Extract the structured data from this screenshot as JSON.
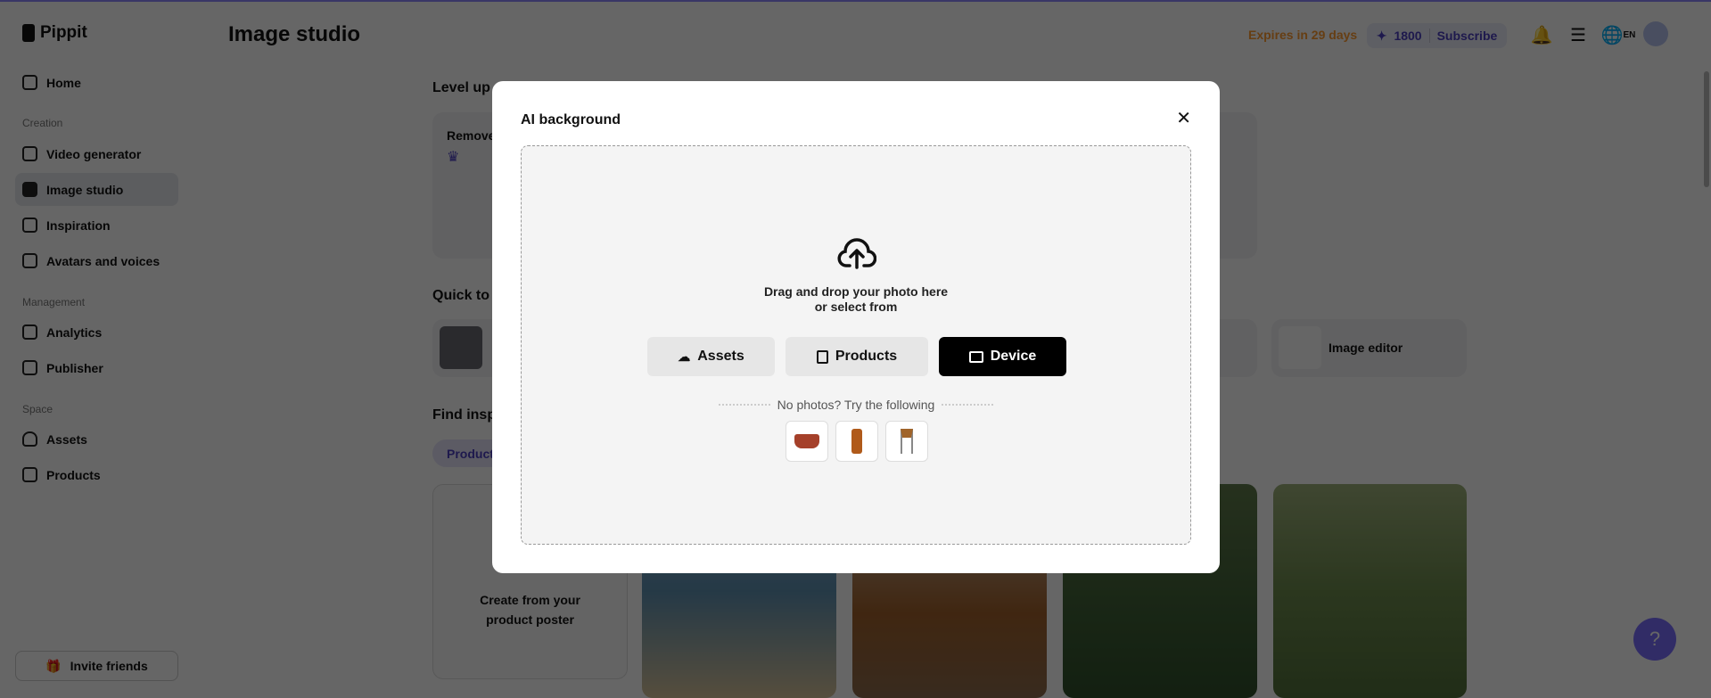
{
  "app": {
    "logo": "Pippit",
    "page_title": "Image studio"
  },
  "header": {
    "expires": "Expires in 29 days",
    "credits": "1800",
    "subscribe": "Subscribe",
    "language": "EN"
  },
  "sidebar": {
    "home": "Home",
    "sections": [
      {
        "label": "Creation",
        "items": [
          "Video generator",
          "Image studio",
          "Inspiration",
          "Avatars and voices"
        ]
      },
      {
        "label": "Management",
        "items": [
          "Analytics",
          "Publisher"
        ]
      },
      {
        "label": "Space",
        "items": [
          "Assets",
          "Products"
        ]
      }
    ],
    "invite": "Invite friends"
  },
  "main": {
    "level_up": "Level up",
    "remove_card": "Remove",
    "quick_tools": "Quick to",
    "image_editor": "Image editor",
    "find_inspiration": "Find insp",
    "chip": "Product",
    "create_poster": "Create from your product poster"
  },
  "modal": {
    "title": "AI background",
    "drag_line1": "Drag and drop your photo here",
    "drag_line2": "or select from",
    "buttons": {
      "assets": "Assets",
      "products": "Products",
      "device": "Device"
    },
    "try_text": "No photos? Try the following",
    "samples": [
      "pot",
      "bottle",
      "chair"
    ]
  },
  "colors": {
    "accent": "#4b3fc0",
    "expires": "#c46a10"
  }
}
